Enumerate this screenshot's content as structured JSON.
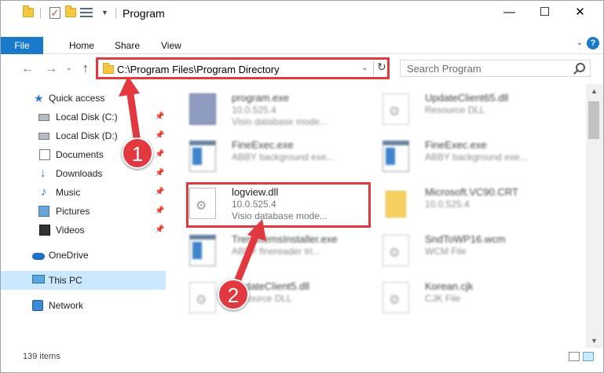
{
  "window": {
    "title": "Program",
    "minimize_glyph": "—",
    "maximize_glyph": "☐",
    "close_glyph": "✕"
  },
  "ribbon": {
    "tabs": [
      "File",
      "Home",
      "Share",
      "View"
    ],
    "expand_glyph": "⌄",
    "help_glyph": "?"
  },
  "address_bar": {
    "path": "C:\\Program Files\\Program Directory",
    "dropdown_glyph": "⌄",
    "refresh_glyph": "↻"
  },
  "search": {
    "placeholder": "Search Program"
  },
  "nav_buttons": {
    "back": "←",
    "forward": "→",
    "recent": "⌄",
    "up": "↑"
  },
  "sidebar": {
    "quick_access": "Quick access",
    "items": [
      {
        "label": "Local Disk (C:)",
        "icon": "drive-icon",
        "pinned": true
      },
      {
        "label": "Local Disk (D:)",
        "icon": "drive-icon",
        "pinned": true
      },
      {
        "label": "Documents",
        "icon": "documents-icon",
        "pinned": true
      },
      {
        "label": "Downloads",
        "icon": "downloads-icon",
        "pinned": true
      },
      {
        "label": "Music",
        "icon": "music-icon",
        "pinned": true
      },
      {
        "label": "Pictures",
        "icon": "pictures-icon",
        "pinned": true
      },
      {
        "label": "Videos",
        "icon": "videos-icon",
        "pinned": true
      }
    ],
    "onedrive": "OneDrive",
    "this_pc": "This PC",
    "network": "Network",
    "pin_glyph": "📌"
  },
  "files": [
    {
      "name": "program.exe",
      "line2": "10.0.525.4",
      "line3": "Visio database mode...",
      "icon": "program-exe-icon"
    },
    {
      "name": "UpdateClient65.dll",
      "line2": "Resource DLL",
      "line3": "",
      "icon": "dll-icon"
    },
    {
      "name": "FineExec.exe",
      "line2": "ABBY background exe...",
      "line3": "",
      "icon": "application-icon"
    },
    {
      "name": "FineExec.exe",
      "line2": "ABBY background exe...",
      "line3": "",
      "icon": "application-icon"
    },
    {
      "name": "logview.dll",
      "line2": "10.0.525.4",
      "line3": "Visio database mode...",
      "icon": "dll-icon"
    },
    {
      "name": "Microsoft.VC90.CRT",
      "line2": "10.0.525.4",
      "line3": "",
      "icon": "folder-icon"
    },
    {
      "name": "TrendItemsInstaller.exe",
      "line2": "ABBY finereader tri...",
      "line3": "",
      "icon": "application-icon"
    },
    {
      "name": "SndToWP16.wcm",
      "line2": "WCM File",
      "line3": "",
      "icon": "file-icon"
    },
    {
      "name": "UpdateClient5.dll",
      "line2": "Resource DLL",
      "line3": "",
      "icon": "dll-icon"
    },
    {
      "name": "Korean.cjk",
      "line2": "CJK File",
      "line3": "",
      "icon": "file-icon"
    }
  ],
  "status": {
    "item_count": "139 items"
  },
  "annotations": {
    "step1": "1",
    "step2": "2",
    "color": "#e2383f"
  },
  "colors": {
    "accent": "#1979ca",
    "selection": "#cce8ff",
    "highlight": "#e2383f"
  }
}
